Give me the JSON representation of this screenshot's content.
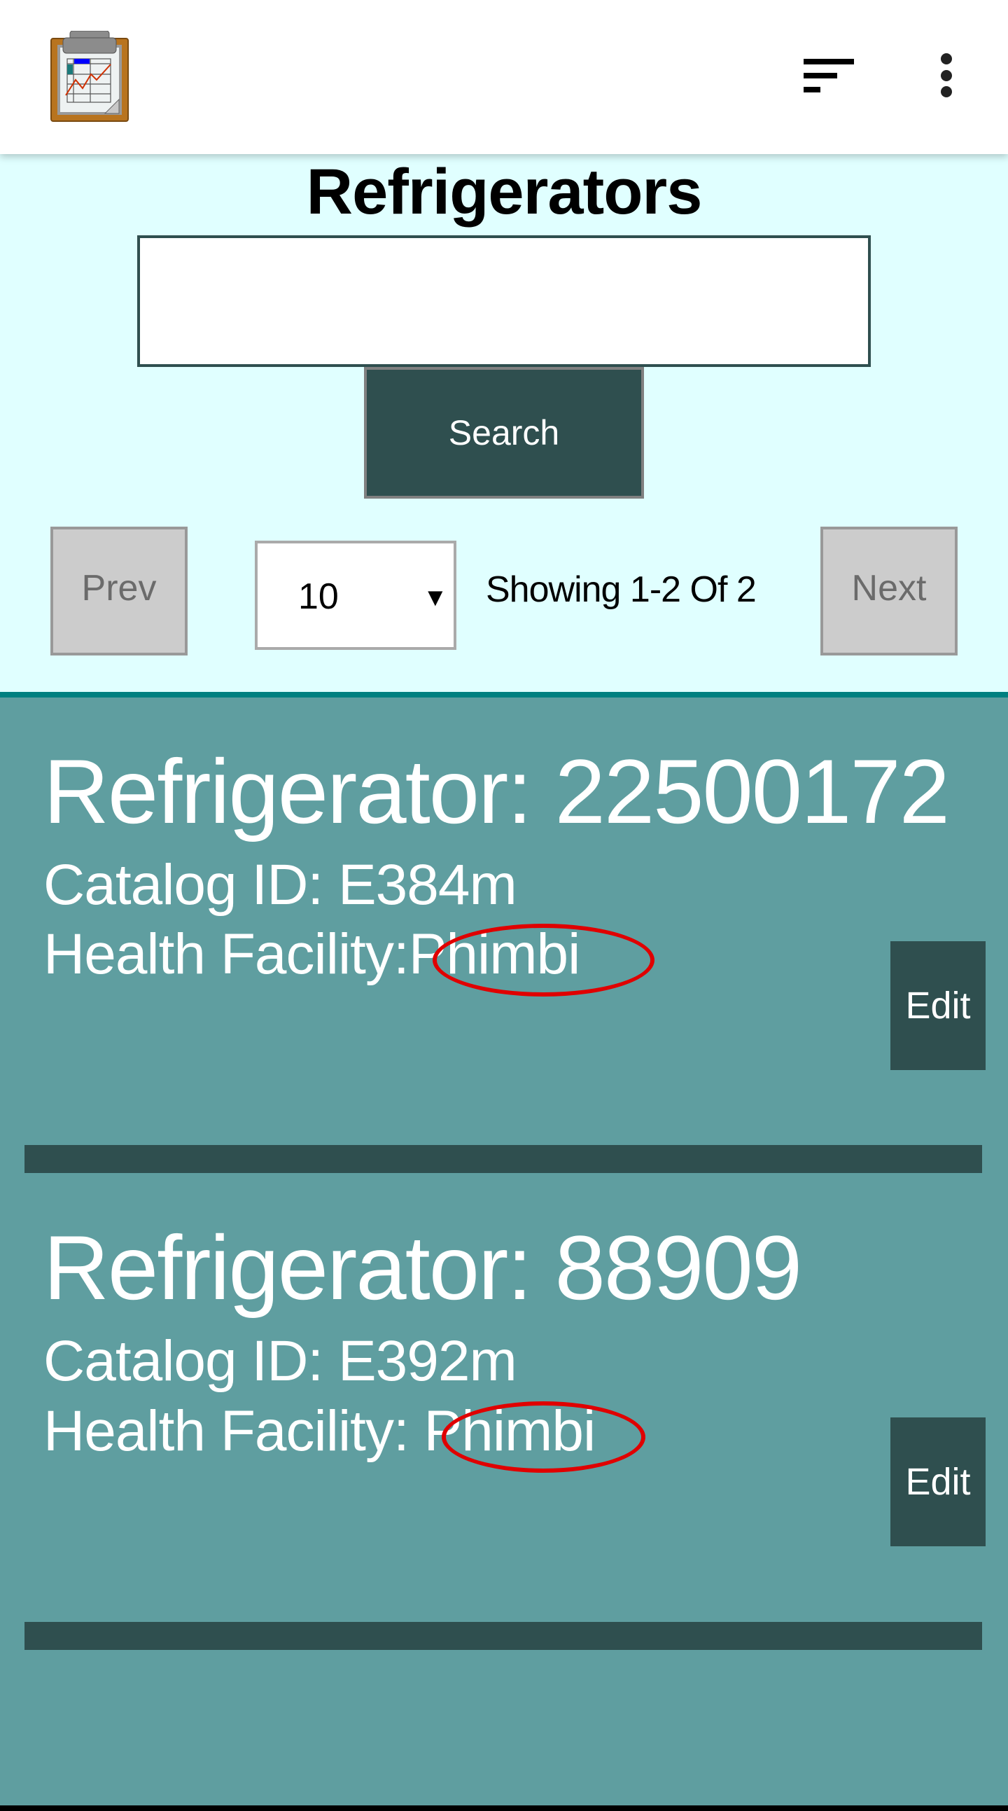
{
  "header": {
    "logo_icon": "clipboard-chart-icon",
    "sort_icon": "sort-icon",
    "menu_icon": "more-vert-icon"
  },
  "page": {
    "title": "Refrigerators"
  },
  "search": {
    "value": "",
    "placeholder": "",
    "button_label": "Search"
  },
  "pager": {
    "prev_label": "Prev",
    "next_label": "Next",
    "page_size": "10",
    "page_size_arrow": "▼",
    "showing_text": "Showing 1-2 Of 2"
  },
  "colors": {
    "panel_bg": "#E0FFFF",
    "list_bg": "#5F9EA0",
    "accent_dark": "#2F4F4F",
    "border_teal": "#008080",
    "highlight": "#E00000"
  },
  "refrigerators": [
    {
      "title": "Refrigerator: 22500172",
      "catalog_label": "Catalog ID: E384m",
      "facility_label": "Health Facility:",
      "facility_value": "Phimbi",
      "edit_label": "Edit"
    },
    {
      "title": "Refrigerator: 88909",
      "catalog_label": "Catalog ID: E392m",
      "facility_label": "Health Facility: ",
      "facility_value": "Phimbi",
      "edit_label": "Edit"
    }
  ]
}
